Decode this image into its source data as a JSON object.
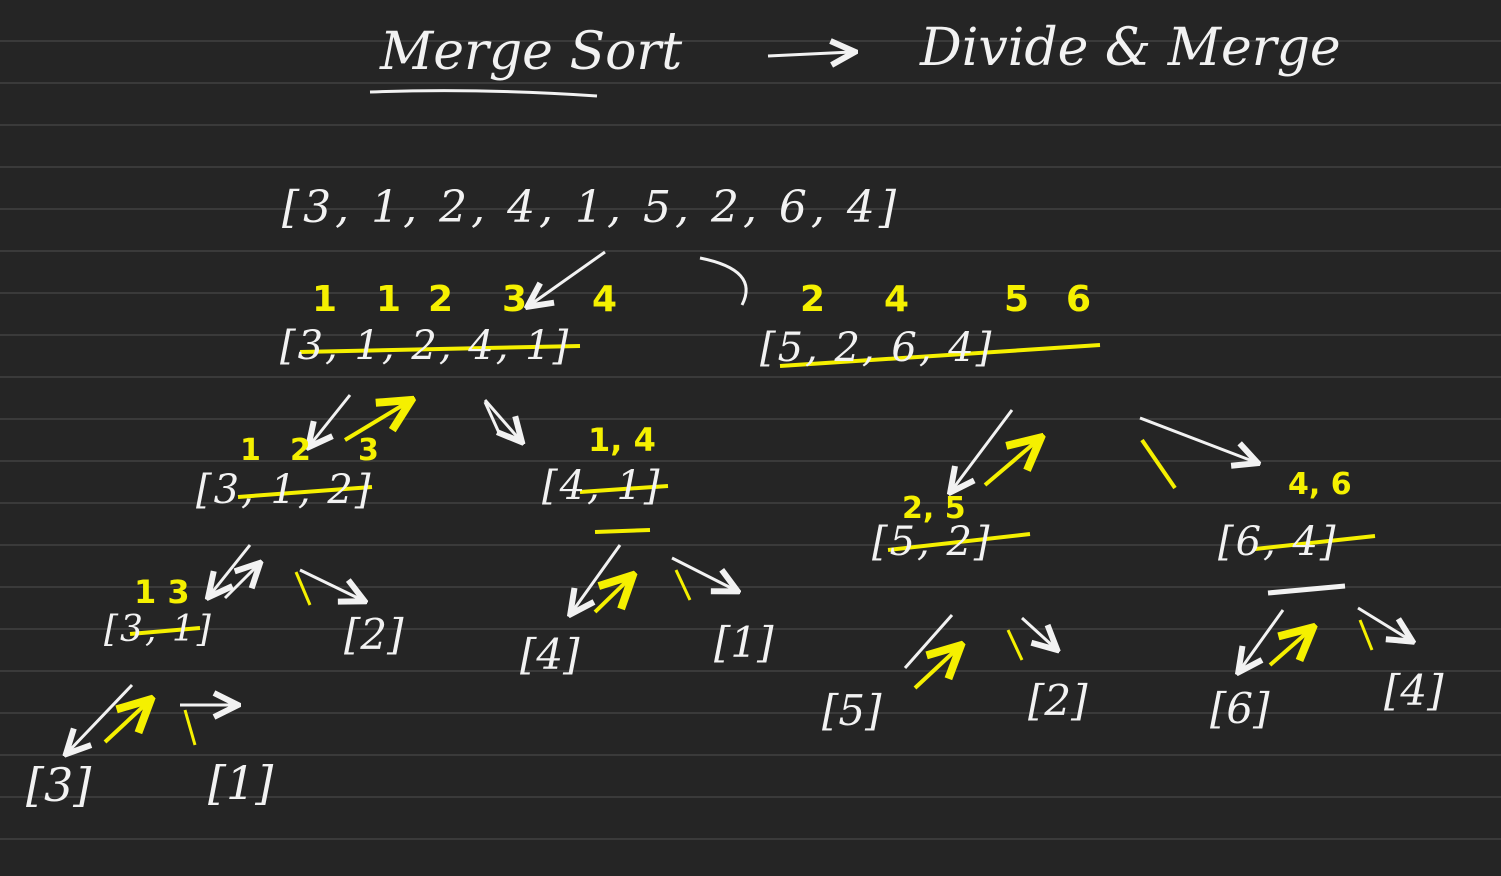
{
  "title": {
    "left": "Merge Sort",
    "right": "Divide & Merge"
  },
  "input_array": "[3, 1, 2, 4, 1, 5, 2, 6, 4]",
  "level1": {
    "left": {
      "array": "[3, 1, 2, 4, 1]",
      "sorted": [
        "1",
        "1",
        "2",
        "3",
        "4"
      ]
    },
    "right": {
      "array": "[5, 2, 6, 4]",
      "sorted": [
        "2",
        "4",
        "5",
        "6"
      ]
    }
  },
  "level2": {
    "left_left": {
      "array": "[3, 1, 2]",
      "sorted": [
        "1",
        "2",
        "3"
      ]
    },
    "left_right": {
      "array": "[4, 1]",
      "sorted": "1, 4"
    },
    "right_left": {
      "array": "[5, 2]",
      "sorted": "2, 5"
    },
    "right_right": {
      "array": "[6, 4]",
      "sorted": "4, 6"
    }
  },
  "level3": {
    "a": {
      "array": "[3, 1]",
      "sorted": "1 3"
    },
    "b": "[2]",
    "c": "[4]",
    "d": "[1]",
    "e": "[5]",
    "f": "[2]",
    "g": "[6]",
    "h": "[4]"
  },
  "level4": {
    "a": "[3]",
    "b": "[1]"
  },
  "colors": {
    "chalk": "#f2f2f2",
    "highlight": "#f5f000",
    "board": "#252525",
    "rule": "#3a3a3a"
  }
}
